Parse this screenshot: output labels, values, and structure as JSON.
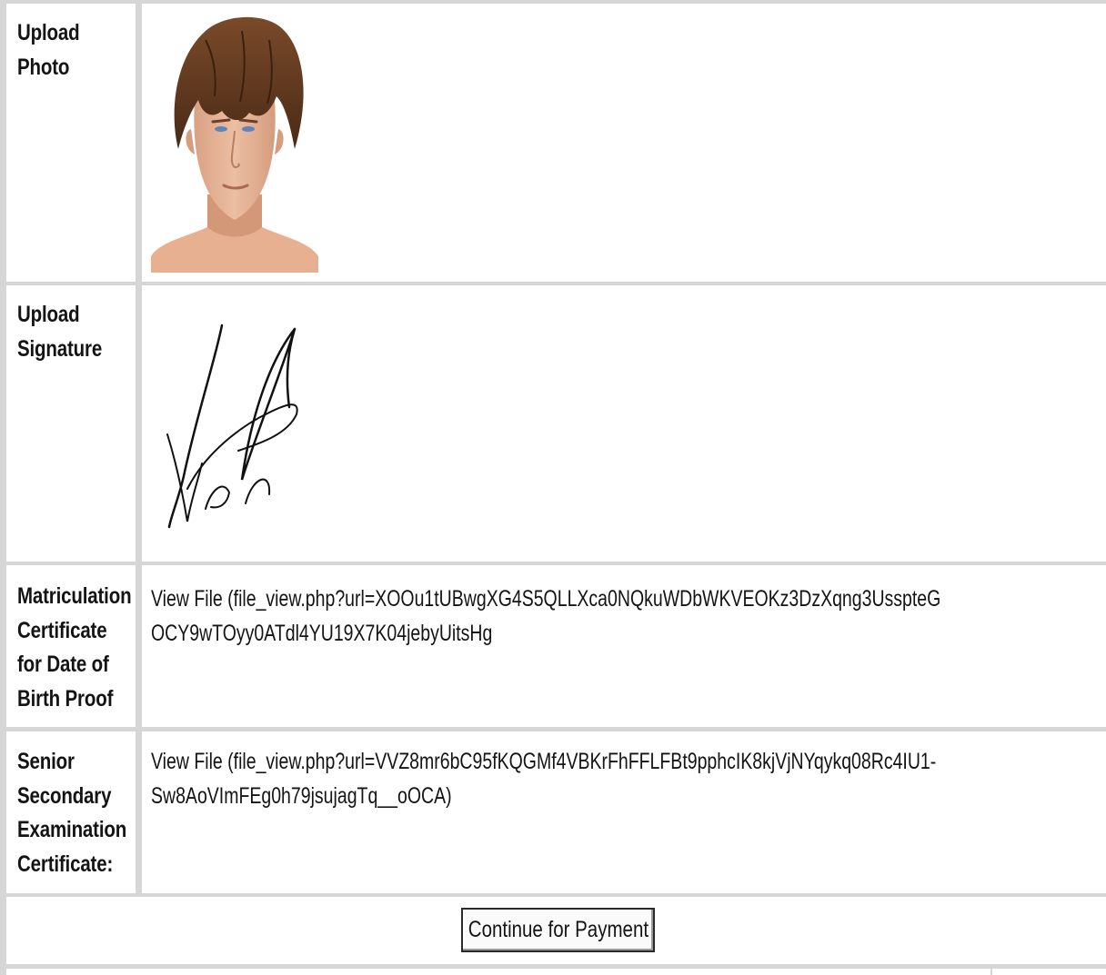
{
  "rows": [
    {
      "label": "Upload Photo"
    },
    {
      "label": "Upload Signature"
    },
    {
      "label": "Matriculation Certificate for Date of Birth Proof",
      "value": "View File (file_view.php?url=XOOu1tUBwgXG4S5QLLXca0NQkuWDbWKVEOKz3DzXqng3UsspteGOCY9wTOyy0ATdl4YU19X7K04jebyUitsHg"
    },
    {
      "label": "Senior Secondary Examination Certificate:",
      "value": "View File (file_view.php?url=VVZ8mr6bC95fKQGMf4VBKrFhFFLFBt9pphcIK8kjVjNYqykq08Rc4IU1-Sw8AoVImFEg0h79jsujagTq__oOCA)"
    }
  ],
  "submit": {
    "label": "Continue for Payment"
  }
}
